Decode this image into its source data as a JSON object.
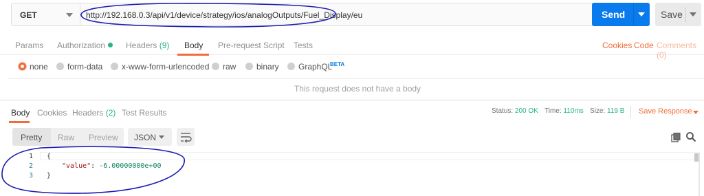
{
  "request": {
    "method": "GET",
    "url": "http://192.168.0.3/api/v1/device/strategy/ios/analogOutputs/Fuel_Display/eu",
    "send_label": "Send",
    "save_label": "Save"
  },
  "request_tabs": [
    {
      "label": "Params"
    },
    {
      "label": "Authorization"
    },
    {
      "label": "Headers",
      "count": "(9)"
    },
    {
      "label": "Body",
      "active": true
    },
    {
      "label": "Pre-request Script"
    },
    {
      "label": "Tests"
    }
  ],
  "request_links": {
    "cookies": "Cookies",
    "code": "Code",
    "comments": "Comments (0)"
  },
  "body_types": [
    {
      "label": "none",
      "selected": true
    },
    {
      "label": "form-data"
    },
    {
      "label": "x-www-form-urlencoded"
    },
    {
      "label": "raw"
    },
    {
      "label": "binary"
    },
    {
      "label": "GraphQL",
      "badge": "BETA"
    }
  ],
  "no_body_message": "This request does not have a body",
  "response_tabs": [
    {
      "label": "Body",
      "active": true
    },
    {
      "label": "Cookies"
    },
    {
      "label": "Headers",
      "count": "(2)"
    },
    {
      "label": "Test Results"
    }
  ],
  "response_meta": {
    "status_label": "Status:",
    "status_value": "200 OK",
    "time_label": "Time:",
    "time_value": "110ms",
    "size_label": "Size:",
    "size_value": "119 B",
    "save_response": "Save Response"
  },
  "view_modes": [
    "Pretty",
    "Raw",
    "Preview"
  ],
  "format": "JSON",
  "code_lines": [
    {
      "n": "1",
      "open": "{"
    },
    {
      "n": "2",
      "key": "\"value\"",
      "sep": ": ",
      "val": "-6.00000000e+00"
    },
    {
      "n": "3",
      "close": "}"
    }
  ],
  "colors": {
    "accent": "#f26b3a",
    "primary": "#097bed",
    "success": "#26b47f",
    "annotation": "#1a1ab0"
  },
  "icons": [
    "chevron-down-icon",
    "wrap-lines-icon",
    "copy-icon",
    "search-icon"
  ]
}
